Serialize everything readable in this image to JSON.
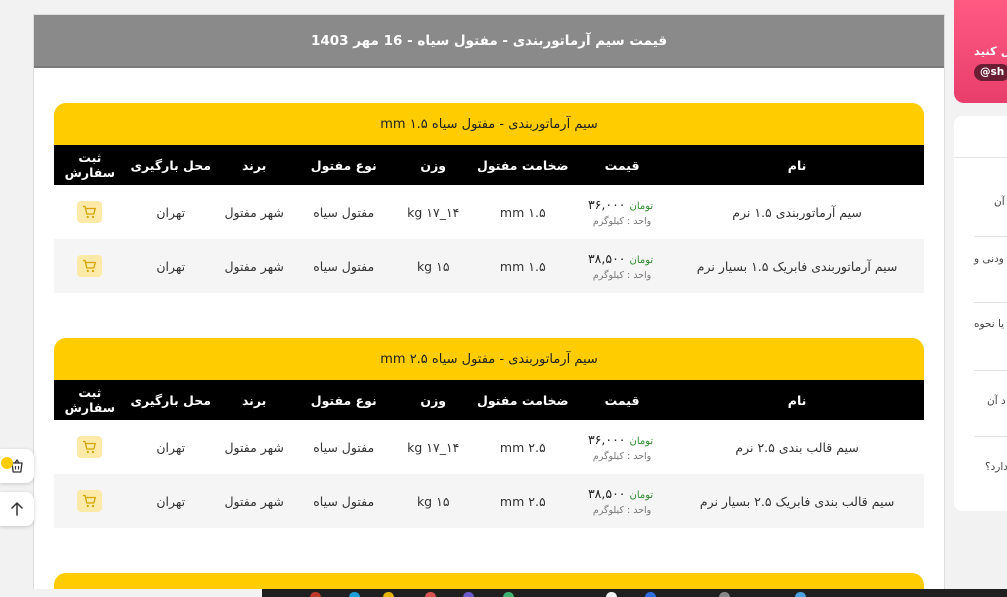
{
  "page": {
    "header_title": "قیمت سیم آرماتوربندی - مفتول سیاه - 16 مهر 1403"
  },
  "columns": [
    "نام",
    "قیمت",
    "ضخامت مفتول",
    "وزن",
    "نوع مفتول",
    "برند",
    "محل بارگیری",
    "ثبت سفارش"
  ],
  "tables": [
    {
      "title": "سیم آرماتوربندی - مفتول سیاه ۱.۵ mm",
      "rows": [
        {
          "name": "سیم آرماتوربندی ۱.۵ نرم",
          "price": "۳۶,۰۰۰",
          "currency": "تومان",
          "unit": "واحد : کیلوگرم",
          "thickness": "۱.۵ mm",
          "weight": "۱۴_۱۷ kg",
          "type": "مفتول سیاه",
          "brand": "شهر مفتول",
          "location": "تهران"
        },
        {
          "name": "سیم آرماتوربندی فابریک ۱.۵ بسیار نرم",
          "price": "۳۸,۵۰۰",
          "currency": "تومان",
          "unit": "واحد : کیلوگرم",
          "thickness": "۱.۵ mm",
          "weight": "۱۵ kg",
          "type": "مفتول سیاه",
          "brand": "شهر مفتول",
          "location": "تهران"
        }
      ]
    },
    {
      "title": "سیم آرماتوربندی - مفتول سیاه ۲.۵ mm",
      "rows": [
        {
          "name": "سیم قالب بندی ۲.۵ نرم",
          "price": "۳۶,۰۰۰",
          "currency": "تومان",
          "unit": "واحد : کیلوگرم",
          "thickness": "۲.۵ mm",
          "weight": "۱۴_۱۷ kg",
          "type": "مفتول سیاه",
          "brand": "شهر مفتول",
          "location": "تهران"
        },
        {
          "name": "سیم قالب بندی فابریک ۲.۵ بسیار نرم",
          "price": "۳۸,۵۰۰",
          "currency": "تومان",
          "unit": "واحد : کیلوگرم",
          "thickness": "۲.۵ mm",
          "weight": "۱۵ kg",
          "type": "مفتول سیاه",
          "brand": "شهر مفتول",
          "location": "تهران"
        }
      ]
    }
  ],
  "promo": {
    "text": "ال کنید",
    "handle": "@sh"
  },
  "faq": [
    "آن",
    "ودنی و",
    "یا نحوه",
    "د آن",
    "دارد؟"
  ],
  "icons": {
    "cart": "cart-icon",
    "scroll_top": "arrow-up-icon",
    "basket": "basket-icon"
  },
  "colors": {
    "accent": "#ffcc00",
    "header_gray": "#8a8a8a",
    "price_currency": "#2e8b2e",
    "promo": "#e83e6c"
  }
}
